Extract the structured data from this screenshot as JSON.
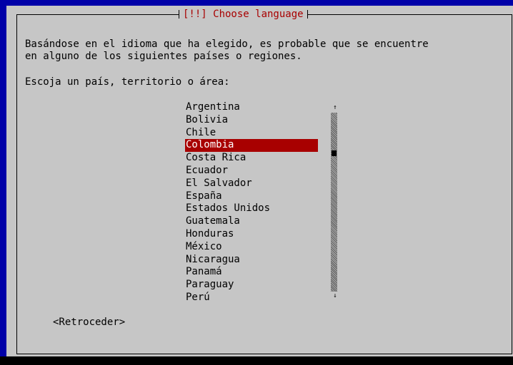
{
  "dialog": {
    "title": "[!!] Choose language",
    "description_line1": "Basándose en el idioma que ha elegido, es probable que se encuentre",
    "description_line2": "en alguno de los siguientes países o regiones.",
    "prompt": "Escoja un país, territorio o área:"
  },
  "country_list": {
    "items": [
      "Argentina",
      "Bolivia",
      "Chile",
      "Colombia",
      "Costa Rica",
      "Ecuador",
      "El Salvador",
      "España",
      "Estados Unidos",
      "Guatemala",
      "Honduras",
      "México",
      "Nicaragua",
      "Panamá",
      "Paraguay",
      "Perú"
    ],
    "selected": "Colombia"
  },
  "scrollbar": {
    "up_arrow": "↑",
    "down_arrow": "↓",
    "thumb_position": 0.22
  },
  "buttons": {
    "back": "<Retroceder>"
  },
  "colors": {
    "background": "#0000a8",
    "dialog": "#c6c6c6",
    "title_text": "#a80000",
    "selection": "#a80000"
  }
}
